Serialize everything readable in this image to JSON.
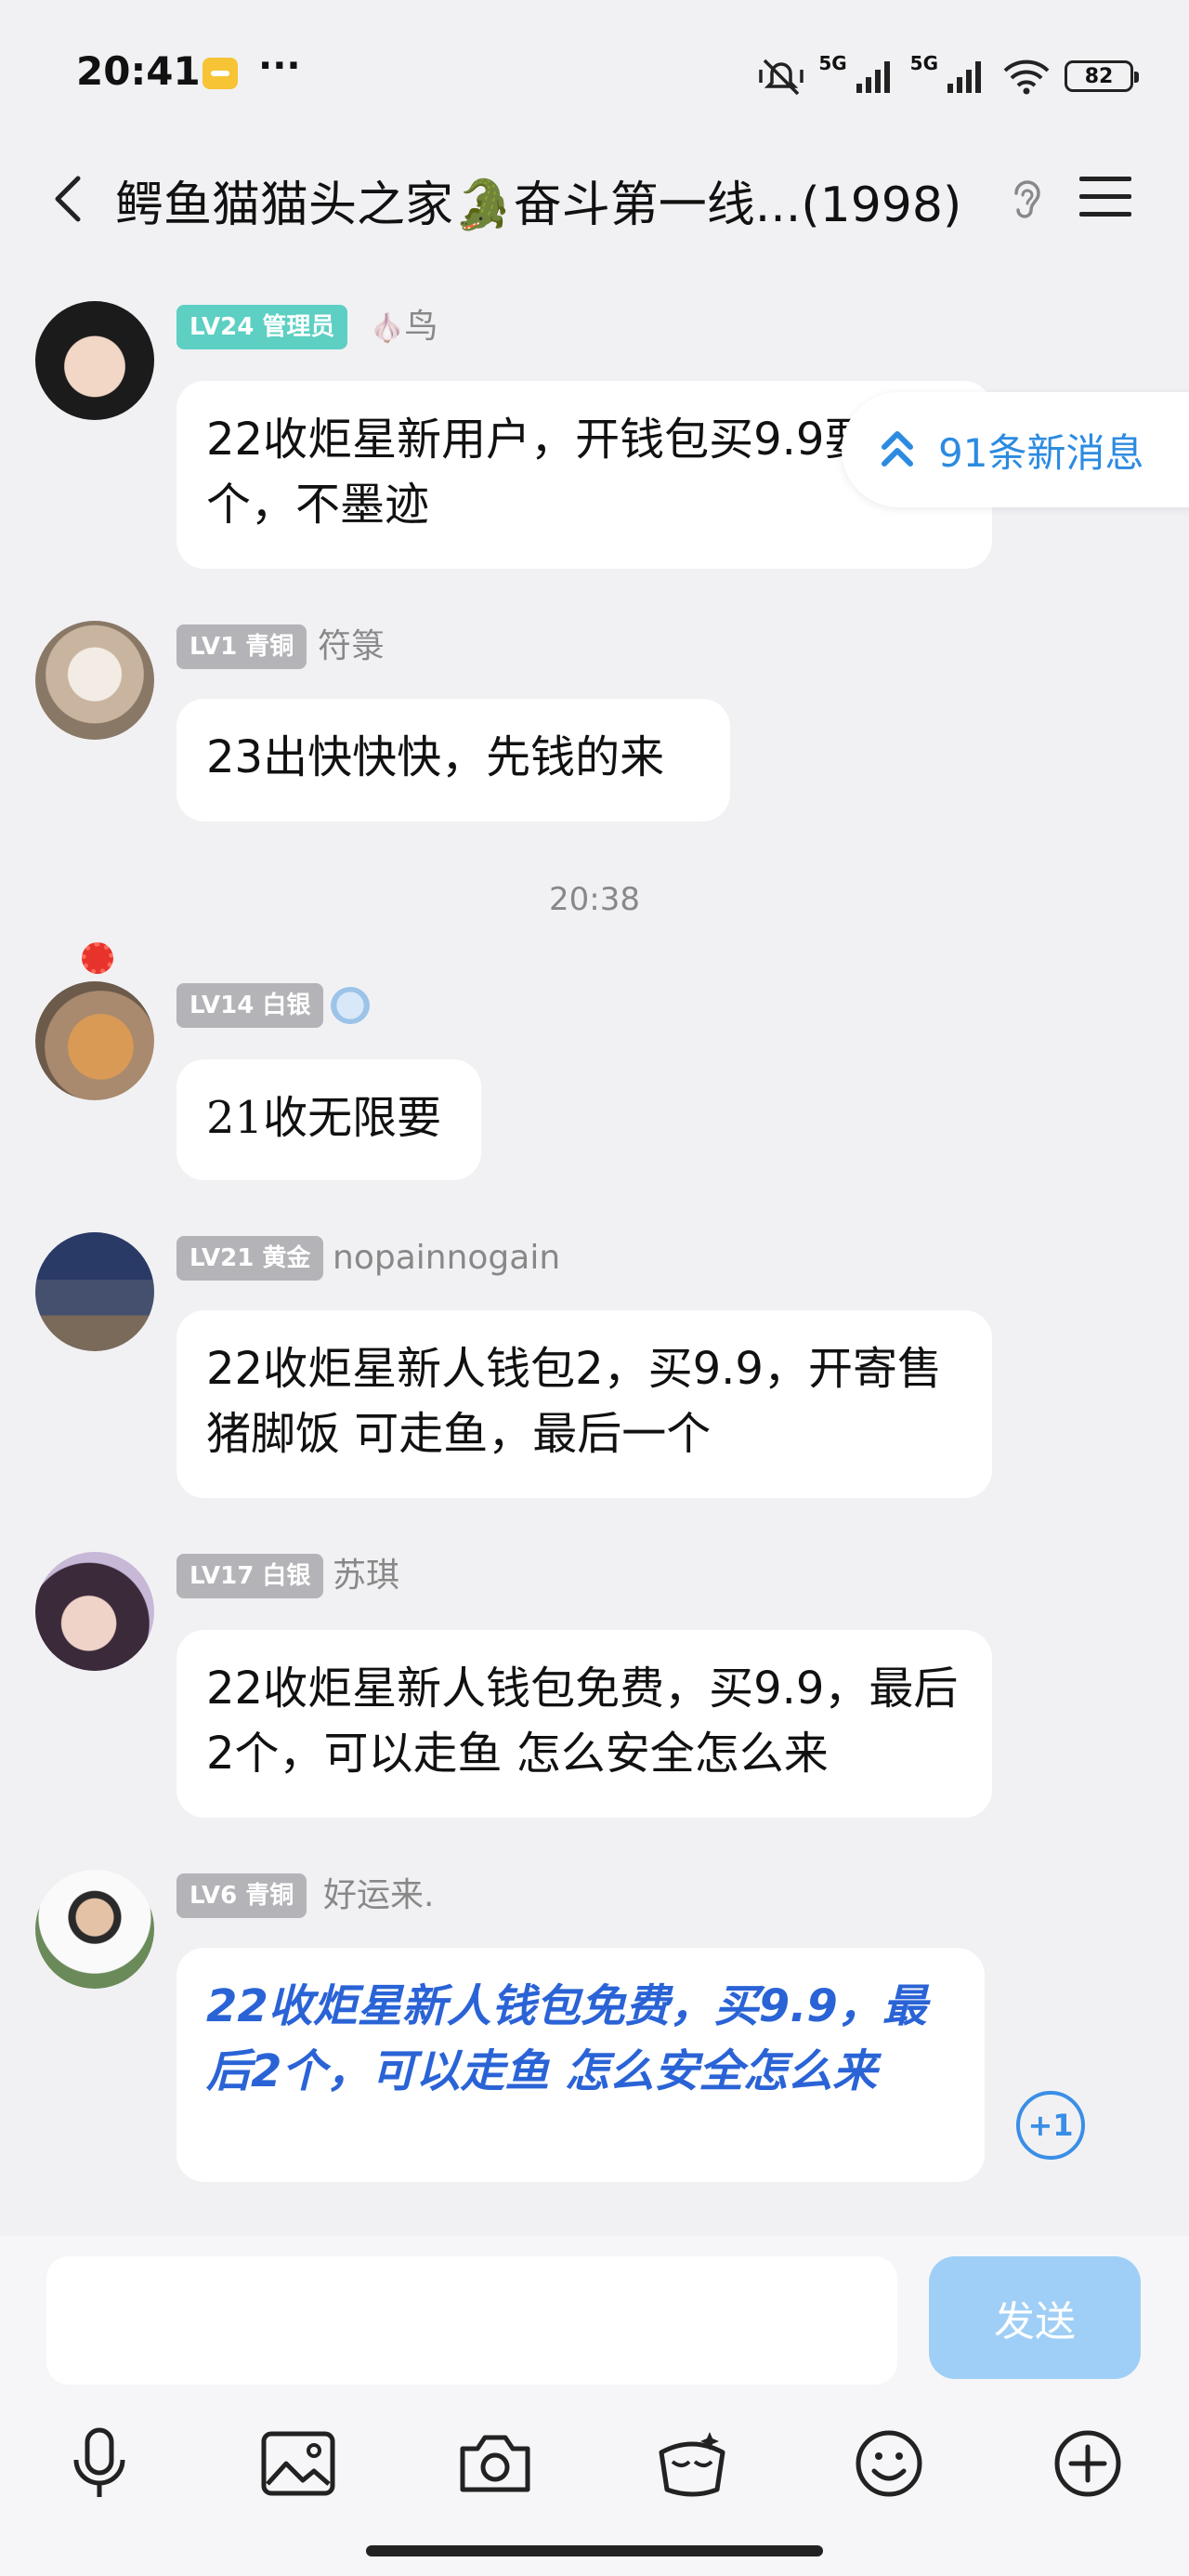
{
  "status_bar": {
    "time": "20:41",
    "dots": "···",
    "network_1": "5G",
    "network_2": "5G",
    "battery": "82"
  },
  "header": {
    "title": "鳄鱼猫猫头之家🐊奋斗第一线...(1998)",
    "icons": [
      "back-icon",
      "ear-icon",
      "menu-icon"
    ]
  },
  "new_messages": {
    "label": "91条新消息"
  },
  "messages": [
    {
      "level": "LV24 管理员",
      "badge_color": "#5dcfc3",
      "name": "鸟",
      "name_prefix": "🧄",
      "text": "22收炬星新用户，开钱包买9.9要两个，不墨迹"
    },
    {
      "level": "LV1 青铜",
      "badge_color": "#b4b4b8",
      "name": "符箓",
      "text": "23出快快快，先钱的来"
    },
    {
      "level": "LV14 白银",
      "badge_color": "#b4b4b8",
      "name": "",
      "text": "21收无限要"
    },
    {
      "level": "LV21 黄金",
      "badge_color": "#b4b4b8",
      "name": "nopainnogain",
      "text": "22收炬星新人钱包2，买9.9，开寄售猪脚饭  可走鱼，最后一个"
    },
    {
      "level": "LV17 白银",
      "badge_color": "#b4b4b8",
      "name": "苏琪",
      "text": "22收炬星新人钱包免费，买9.9，最后2个，可以走鱼 怎么安全怎么来"
    },
    {
      "level": "LV6 青铜",
      "badge_color": "#b4b4b8",
      "name": "好运来.",
      "text": "22收炬星新人钱包免费，买9.9，最后2个，可以走鱼 怎么安全怎么来"
    }
  ],
  "timestamp": "20:38",
  "plus_one": "+1",
  "input": {
    "placeholder": "",
    "send_label": "发送"
  },
  "toolbar": [
    "mic-icon",
    "image-icon",
    "camera-icon",
    "red-packet-icon",
    "emoji-icon",
    "plus-icon"
  ],
  "colors": {
    "accent": "#2c8be0",
    "send_button": "#9fcff6",
    "background": "#f1f1f4"
  }
}
